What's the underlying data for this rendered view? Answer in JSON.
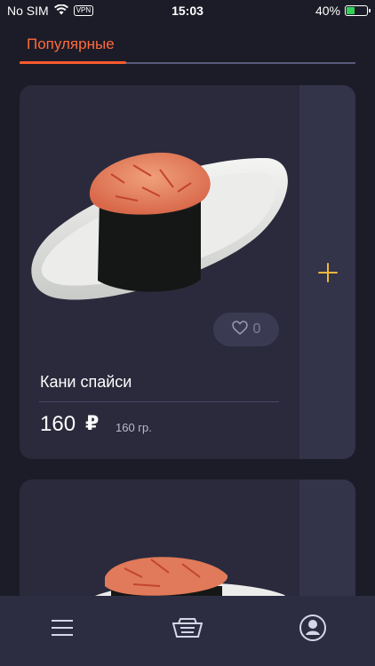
{
  "status": {
    "carrier": "No SIM",
    "vpn": "VPN",
    "time": "15:03",
    "battery": "40%"
  },
  "tabs": [
    {
      "label": "Популярные",
      "active": true
    }
  ],
  "products": [
    {
      "name": "Кани спайси",
      "price": "160",
      "currency": "₽",
      "weight": "160 гр.",
      "likes": "0"
    }
  ],
  "icons": {
    "add": "plus-icon",
    "like": "heart-icon",
    "menu": "menu-icon",
    "cart": "basket-icon",
    "profile": "profile-icon"
  },
  "colors": {
    "accent": "#ff6a3d",
    "plus": "#f4b73a",
    "background": "#1c1c28",
    "card": "#2a2a3c"
  }
}
